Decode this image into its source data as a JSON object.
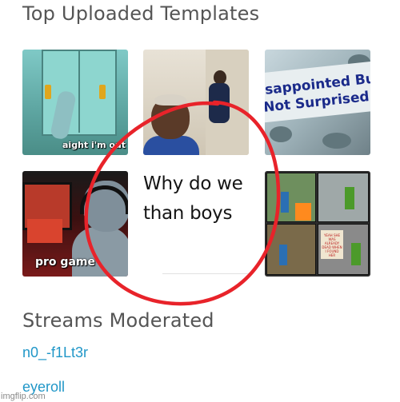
{
  "sections": {
    "top_templates_title": "Top Uploaded Templates",
    "streams_title": "Streams Moderated"
  },
  "templates": [
    {
      "caption": "aight i'm out",
      "icon": "squidward-thumbnail"
    },
    {
      "caption": "",
      "icon": "man-looking-back-thumbnail"
    },
    {
      "caption_lines": [
        "isappointed Bu",
        "Not Surprised"
      ],
      "icon": "disappointed-thumbnail"
    },
    {
      "caption": "pro game",
      "icon": "pro-gamer-thumbnail"
    },
    {
      "caption_lines": [
        "Why do we",
        "than boys"
      ],
      "icon": "text-meme-thumbnail"
    },
    {
      "sign_text": "YEAH SHE WAS ALREADY DEAD WHEN I FOUND HER",
      "icon": "minecraft-comic-thumbnail"
    }
  ],
  "streams": [
    "n0_-f1Lt3r",
    "eyeroll"
  ],
  "watermark": "imgflip.com",
  "colors": {
    "link": "#2197c8",
    "heading": "#555555",
    "annotation_circle": "#e8232a"
  }
}
